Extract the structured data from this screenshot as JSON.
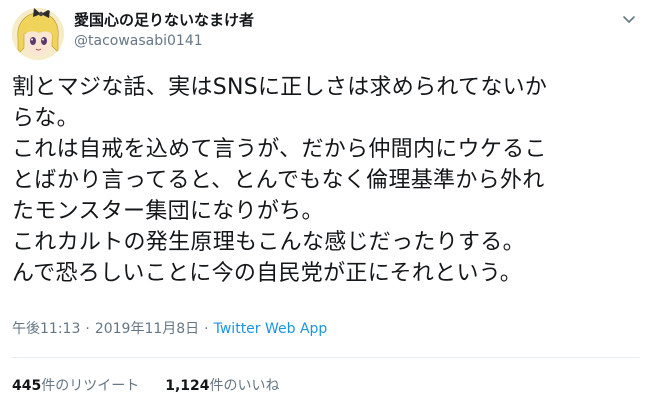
{
  "user": {
    "display_name": "愛国心の足りないなまけ者",
    "handle": "@tacowasabi0141"
  },
  "icons": {
    "avatar": "avatar-illustration",
    "menu": "chevron-down-icon"
  },
  "tweet": {
    "lines": [
      "割とマジな話、実はSNSに正しさは求められてないか",
      "らな。",
      "これは自戒を込めて言うが、だから仲間内にウケるこ",
      "とばかり言ってると、とんでもなく倫理基準から外れ",
      "たモンスター集団になりがち。",
      "これカルトの発生原理もこんな感じだったりする。",
      "んで恐ろしいことに今の自民党が正にそれという。"
    ]
  },
  "meta": {
    "time": "午後11:13",
    "separator": "·",
    "date": "2019年11月8日",
    "source": "Twitter Web App"
  },
  "stats": {
    "retweets_count": "445",
    "retweets_label": "件のリツイート",
    "likes_count": "1,124",
    "likes_label": "件のいいね"
  },
  "colors": {
    "text": "#14171a",
    "secondary": "#657786",
    "link": "#1b95e0",
    "divider": "#e6ecf0"
  }
}
